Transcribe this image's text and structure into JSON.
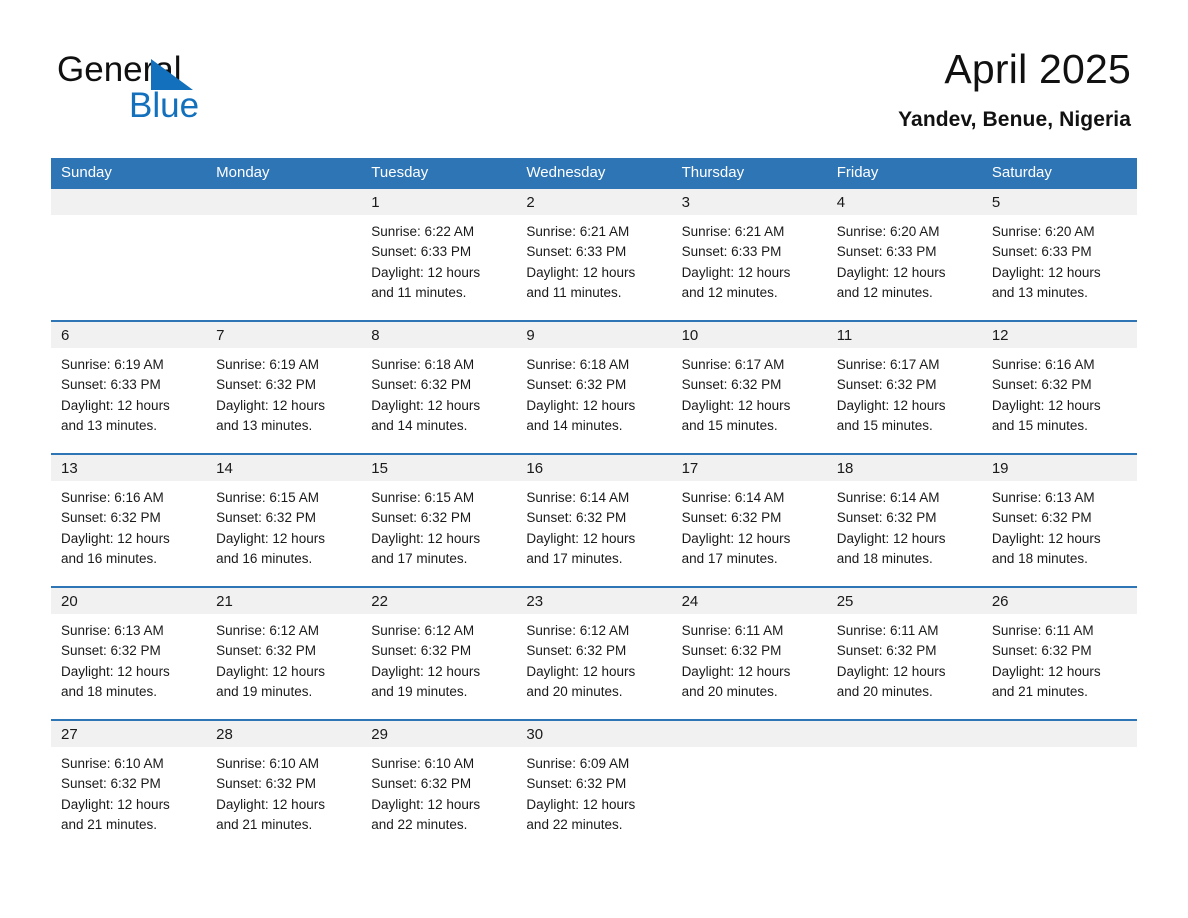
{
  "brand": {
    "word_one": "General",
    "word_two": "Blue",
    "triangle_icon": "triangle-icon",
    "accent_color": "#1270bd"
  },
  "header": {
    "title": "April 2025",
    "subtitle": "Yandev, Benue, Nigeria"
  },
  "theme": {
    "header_blue": "#2e75b6",
    "daynum_band": "#f1f1f1",
    "text": "#1a1a1a"
  },
  "calendar": {
    "weekday_headers": [
      "Sunday",
      "Monday",
      "Tuesday",
      "Wednesday",
      "Thursday",
      "Friday",
      "Saturday"
    ],
    "weeks": [
      [
        {
          "day": "",
          "sunrise": "",
          "sunset": "",
          "daylight": "",
          "empty": true
        },
        {
          "day": "",
          "sunrise": "",
          "sunset": "",
          "daylight": "",
          "empty": true
        },
        {
          "day": "1",
          "sunrise": "Sunrise: 6:22 AM",
          "sunset": "Sunset: 6:33 PM",
          "daylight": "Daylight: 12 hours and 11 minutes.",
          "empty": false
        },
        {
          "day": "2",
          "sunrise": "Sunrise: 6:21 AM",
          "sunset": "Sunset: 6:33 PM",
          "daylight": "Daylight: 12 hours and 11 minutes.",
          "empty": false
        },
        {
          "day": "3",
          "sunrise": "Sunrise: 6:21 AM",
          "sunset": "Sunset: 6:33 PM",
          "daylight": "Daylight: 12 hours and 12 minutes.",
          "empty": false
        },
        {
          "day": "4",
          "sunrise": "Sunrise: 6:20 AM",
          "sunset": "Sunset: 6:33 PM",
          "daylight": "Daylight: 12 hours and 12 minutes.",
          "empty": false
        },
        {
          "day": "5",
          "sunrise": "Sunrise: 6:20 AM",
          "sunset": "Sunset: 6:33 PM",
          "daylight": "Daylight: 12 hours and 13 minutes.",
          "empty": false
        }
      ],
      [
        {
          "day": "6",
          "sunrise": "Sunrise: 6:19 AM",
          "sunset": "Sunset: 6:33 PM",
          "daylight": "Daylight: 12 hours and 13 minutes.",
          "empty": false
        },
        {
          "day": "7",
          "sunrise": "Sunrise: 6:19 AM",
          "sunset": "Sunset: 6:32 PM",
          "daylight": "Daylight: 12 hours and 13 minutes.",
          "empty": false
        },
        {
          "day": "8",
          "sunrise": "Sunrise: 6:18 AM",
          "sunset": "Sunset: 6:32 PM",
          "daylight": "Daylight: 12 hours and 14 minutes.",
          "empty": false
        },
        {
          "day": "9",
          "sunrise": "Sunrise: 6:18 AM",
          "sunset": "Sunset: 6:32 PM",
          "daylight": "Daylight: 12 hours and 14 minutes.",
          "empty": false
        },
        {
          "day": "10",
          "sunrise": "Sunrise: 6:17 AM",
          "sunset": "Sunset: 6:32 PM",
          "daylight": "Daylight: 12 hours and 15 minutes.",
          "empty": false
        },
        {
          "day": "11",
          "sunrise": "Sunrise: 6:17 AM",
          "sunset": "Sunset: 6:32 PM",
          "daylight": "Daylight: 12 hours and 15 minutes.",
          "empty": false
        },
        {
          "day": "12",
          "sunrise": "Sunrise: 6:16 AM",
          "sunset": "Sunset: 6:32 PM",
          "daylight": "Daylight: 12 hours and 15 minutes.",
          "empty": false
        }
      ],
      [
        {
          "day": "13",
          "sunrise": "Sunrise: 6:16 AM",
          "sunset": "Sunset: 6:32 PM",
          "daylight": "Daylight: 12 hours and 16 minutes.",
          "empty": false
        },
        {
          "day": "14",
          "sunrise": "Sunrise: 6:15 AM",
          "sunset": "Sunset: 6:32 PM",
          "daylight": "Daylight: 12 hours and 16 minutes.",
          "empty": false
        },
        {
          "day": "15",
          "sunrise": "Sunrise: 6:15 AM",
          "sunset": "Sunset: 6:32 PM",
          "daylight": "Daylight: 12 hours and 17 minutes.",
          "empty": false
        },
        {
          "day": "16",
          "sunrise": "Sunrise: 6:14 AM",
          "sunset": "Sunset: 6:32 PM",
          "daylight": "Daylight: 12 hours and 17 minutes.",
          "empty": false
        },
        {
          "day": "17",
          "sunrise": "Sunrise: 6:14 AM",
          "sunset": "Sunset: 6:32 PM",
          "daylight": "Daylight: 12 hours and 17 minutes.",
          "empty": false
        },
        {
          "day": "18",
          "sunrise": "Sunrise: 6:14 AM",
          "sunset": "Sunset: 6:32 PM",
          "daylight": "Daylight: 12 hours and 18 minutes.",
          "empty": false
        },
        {
          "day": "19",
          "sunrise": "Sunrise: 6:13 AM",
          "sunset": "Sunset: 6:32 PM",
          "daylight": "Daylight: 12 hours and 18 minutes.",
          "empty": false
        }
      ],
      [
        {
          "day": "20",
          "sunrise": "Sunrise: 6:13 AM",
          "sunset": "Sunset: 6:32 PM",
          "daylight": "Daylight: 12 hours and 18 minutes.",
          "empty": false
        },
        {
          "day": "21",
          "sunrise": "Sunrise: 6:12 AM",
          "sunset": "Sunset: 6:32 PM",
          "daylight": "Daylight: 12 hours and 19 minutes.",
          "empty": false
        },
        {
          "day": "22",
          "sunrise": "Sunrise: 6:12 AM",
          "sunset": "Sunset: 6:32 PM",
          "daylight": "Daylight: 12 hours and 19 minutes.",
          "empty": false
        },
        {
          "day": "23",
          "sunrise": "Sunrise: 6:12 AM",
          "sunset": "Sunset: 6:32 PM",
          "daylight": "Daylight: 12 hours and 20 minutes.",
          "empty": false
        },
        {
          "day": "24",
          "sunrise": "Sunrise: 6:11 AM",
          "sunset": "Sunset: 6:32 PM",
          "daylight": "Daylight: 12 hours and 20 minutes.",
          "empty": false
        },
        {
          "day": "25",
          "sunrise": "Sunrise: 6:11 AM",
          "sunset": "Sunset: 6:32 PM",
          "daylight": "Daylight: 12 hours and 20 minutes.",
          "empty": false
        },
        {
          "day": "26",
          "sunrise": "Sunrise: 6:11 AM",
          "sunset": "Sunset: 6:32 PM",
          "daylight": "Daylight: 12 hours and 21 minutes.",
          "empty": false
        }
      ],
      [
        {
          "day": "27",
          "sunrise": "Sunrise: 6:10 AM",
          "sunset": "Sunset: 6:32 PM",
          "daylight": "Daylight: 12 hours and 21 minutes.",
          "empty": false
        },
        {
          "day": "28",
          "sunrise": "Sunrise: 6:10 AM",
          "sunset": "Sunset: 6:32 PM",
          "daylight": "Daylight: 12 hours and 21 minutes.",
          "empty": false
        },
        {
          "day": "29",
          "sunrise": "Sunrise: 6:10 AM",
          "sunset": "Sunset: 6:32 PM",
          "daylight": "Daylight: 12 hours and 22 minutes.",
          "empty": false
        },
        {
          "day": "30",
          "sunrise": "Sunrise: 6:09 AM",
          "sunset": "Sunset: 6:32 PM",
          "daylight": "Daylight: 12 hours and 22 minutes.",
          "empty": false
        },
        {
          "day": "",
          "sunrise": "",
          "sunset": "",
          "daylight": "",
          "empty": true
        },
        {
          "day": "",
          "sunrise": "",
          "sunset": "",
          "daylight": "",
          "empty": true
        },
        {
          "day": "",
          "sunrise": "",
          "sunset": "",
          "daylight": "",
          "empty": true
        }
      ]
    ]
  }
}
